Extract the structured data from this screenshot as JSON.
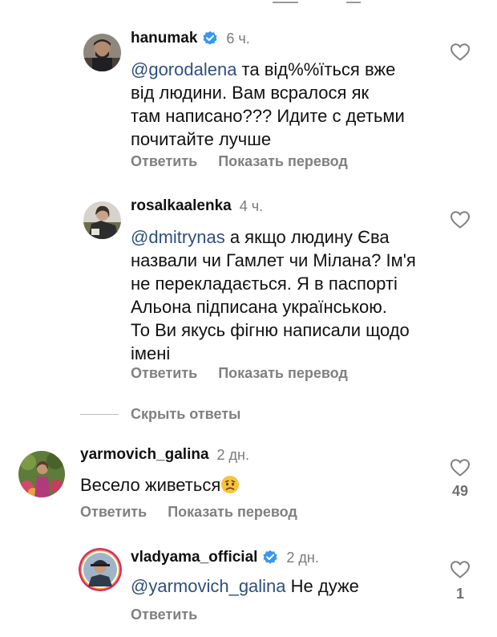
{
  "comments": [
    {
      "username": "hanumak",
      "verified": true,
      "time": "6 ч.",
      "mention": "@gorodalena",
      "text_lines": [
        " та від%%їться вже",
        "від людини. Вам всралося як",
        "там написано??? Идите с детьми",
        "почитайте лучше"
      ],
      "reply_label": "Ответить",
      "translate_label": "Показать перевод",
      "avatar_icon": "bearded-man-avatar-icon"
    },
    {
      "username": "rosalkaalenka",
      "verified": false,
      "time": "4 ч.",
      "mention": "@dmitrynas",
      "text_lines": [
        " а якщо людину Єва",
        "назвали чи Гамлет чи Мілана? Ім'я",
        "не перекладається. Я в паспорті",
        "Альона підписана українською.",
        "То Ви якусь фігню написали щодо",
        "імені"
      ],
      "reply_label": "Ответить",
      "translate_label": "Показать перевод",
      "avatar_icon": "woman-avatar-icon"
    },
    {
      "username": "yarmovich_galina",
      "verified": false,
      "time": "2 дн.",
      "text": "Весело живеться",
      "emoji": "worried-face-emoji",
      "reply_label": "Ответить",
      "translate_label": "Показать перевод",
      "like_count": "49",
      "avatar_icon": "flowers-avatar-icon"
    },
    {
      "username": "vladyama_official",
      "verified": true,
      "time": "2 дн.",
      "mention": "@yarmovich_galina",
      "text": " Не дуже",
      "reply_label": "Ответить",
      "like_count": "1",
      "avatar_icon": "man-in-cap-avatar-icon"
    }
  ],
  "hide_replies_label": "Скрыть ответы",
  "colors": {
    "mention": "#2f4f7f",
    "verified": "#3897f0",
    "secondary_text": "#808080"
  }
}
